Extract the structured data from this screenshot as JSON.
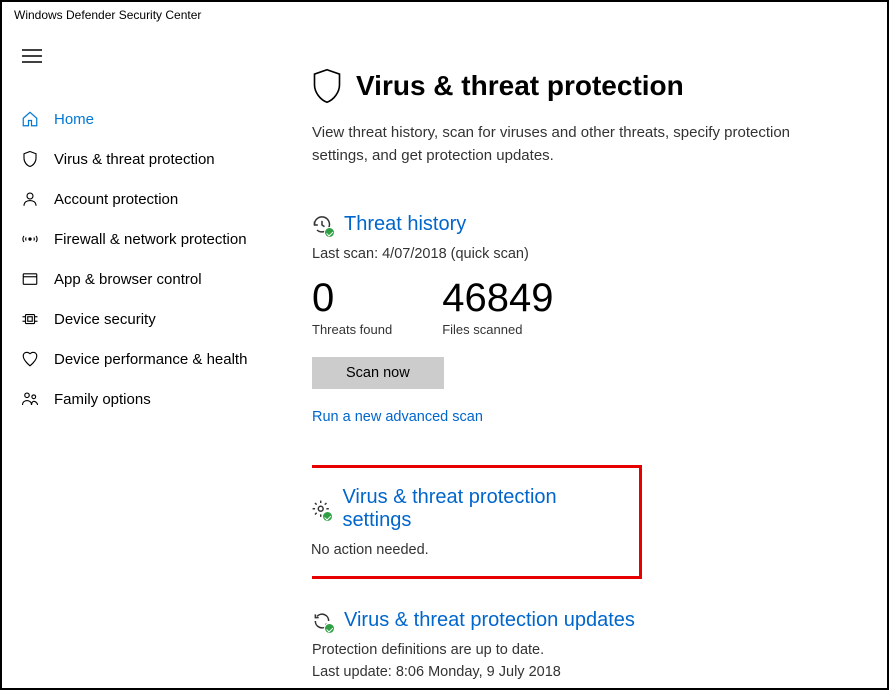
{
  "window": {
    "title": "Windows Defender Security Center"
  },
  "sidebar": {
    "items": [
      {
        "label": "Home"
      },
      {
        "label": "Virus & threat protection"
      },
      {
        "label": "Account protection"
      },
      {
        "label": "Firewall & network protection"
      },
      {
        "label": "App & browser control"
      },
      {
        "label": "Device security"
      },
      {
        "label": "Device performance & health"
      },
      {
        "label": "Family options"
      }
    ]
  },
  "main": {
    "title": "Virus & threat protection",
    "subtitle": "View threat history, scan for viruses and other threats, specify protection settings, and get protection updates.",
    "threat_history": {
      "heading": "Threat history",
      "last_scan": "Last scan: 4/07/2018 (quick scan)",
      "threats_found_value": "0",
      "threats_found_label": "Threats found",
      "files_scanned_value": "46849",
      "files_scanned_label": "Files scanned",
      "scan_button": "Scan now",
      "advanced_link": "Run a new advanced scan"
    },
    "settings": {
      "heading": "Virus & threat protection settings",
      "status": "No action needed."
    },
    "updates": {
      "heading": "Virus & threat protection updates",
      "status": "Protection definitions are up to date.",
      "last_update": "Last update: 8:06 Monday, 9 July 2018"
    }
  }
}
